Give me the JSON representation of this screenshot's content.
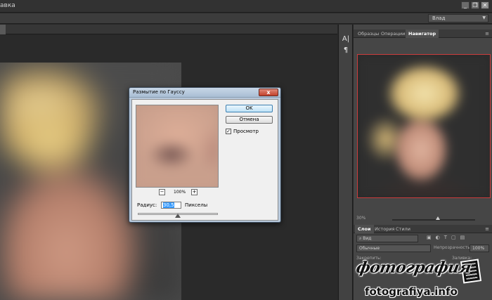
{
  "menubar": {
    "title_fragment": "авка"
  },
  "window_controls": {
    "minimize": "_",
    "restore": "❐",
    "close": "✕"
  },
  "options_bar": {
    "workspace_value": "Влад"
  },
  "navigator_panel": {
    "tabs": [
      {
        "label": "Образцы",
        "active": false
      },
      {
        "label": "Операции",
        "active": false
      },
      {
        "label": "Навигатор",
        "active": true
      }
    ],
    "zoom_percent": "30%",
    "zoom_level_fraction": 0.55,
    "view_box_color": "#cc3c3c"
  },
  "tool_strip": {
    "icons": [
      "A|",
      "¶"
    ]
  },
  "layers_panel": {
    "tabs": [
      {
        "label": "Слои",
        "active": true
      },
      {
        "label": "История",
        "active": false
      },
      {
        "label": "Стили",
        "active": false
      }
    ],
    "kind_filter": "Вид",
    "blend_mode": "Обычные",
    "opacity_label": "Непрозрачность:",
    "opacity_value": "100%",
    "lock_label": "Закрепить:",
    "fill_label": "Заливка:"
  },
  "dialog": {
    "title": "Размытие по Гауссу",
    "close": "x",
    "ok_label": "OK",
    "cancel_label": "Отмена",
    "preview_label": "Просмотр",
    "preview_checked": true,
    "zoom_minus": "−",
    "zoom_plus": "+",
    "zoom_percent": "100%",
    "radius_label": "Радиус:",
    "radius_value": "30,5",
    "radius_unit": "Пикселы",
    "slider_fraction": 0.5
  },
  "watermark": {
    "title": "фотография",
    "url": "fotografiya.info"
  }
}
